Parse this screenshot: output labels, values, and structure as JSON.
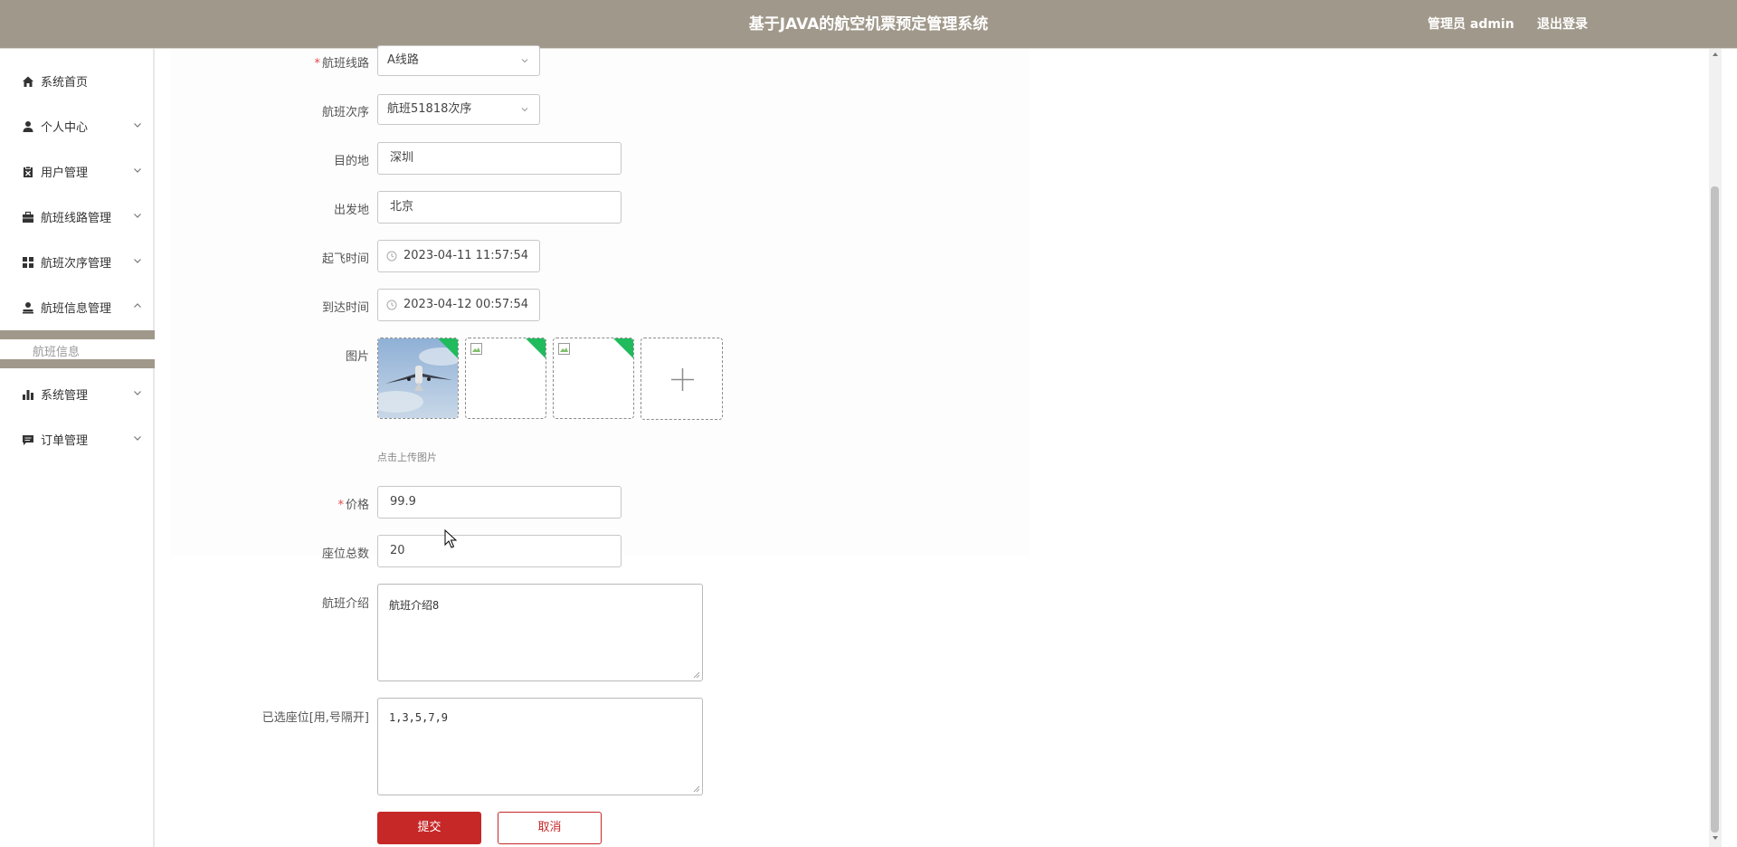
{
  "header": {
    "title": "基于JAVA的航空机票预定管理系统",
    "user": "管理员 admin",
    "logout": "退出登录"
  },
  "sidebar": {
    "items": [
      {
        "label": "系统首页",
        "icon": "home-icon"
      },
      {
        "label": "个人中心",
        "icon": "user-icon"
      },
      {
        "label": "用户管理",
        "icon": "clipboard-icon"
      },
      {
        "label": "航班线路管理",
        "icon": "briefcase-icon"
      },
      {
        "label": "航班次序管理",
        "icon": "grid-icon"
      },
      {
        "label": "航班信息管理",
        "icon": "person-icon"
      },
      {
        "label": "系统管理",
        "icon": "bar-chart-icon"
      },
      {
        "label": "订单管理",
        "icon": "message-icon"
      }
    ],
    "sub_item": "航班信息"
  },
  "form": {
    "route": {
      "label": "航班线路",
      "value": "A线路",
      "required": true
    },
    "sequence": {
      "label": "航班次序",
      "value": "航班51818次序"
    },
    "destination": {
      "label": "目的地",
      "value": "深圳"
    },
    "origin": {
      "label": "出发地",
      "value": "北京"
    },
    "depart_time": {
      "label": "起飞时间",
      "value": "2023-04-11 11:57:54"
    },
    "arrive_time": {
      "label": "到达时间",
      "value": "2023-04-12 00:57:54"
    },
    "images": {
      "label": "图片",
      "count": 3,
      "hint": "点击上传图片"
    },
    "price": {
      "label": "价格",
      "value": "99.9",
      "required": true
    },
    "seats": {
      "label": "座位总数",
      "value": "20"
    },
    "intro": {
      "label": "航班介绍",
      "value": "航班介绍8"
    },
    "selected_seats": {
      "label": "已选座位[用,号隔开]",
      "value": "1,3,5,7,9"
    }
  },
  "buttons": {
    "submit": "提交",
    "cancel": "取消"
  },
  "colors": {
    "header_bg": "#a0988a",
    "primary": "#c62828",
    "badge_green": "#1fbb5c"
  }
}
